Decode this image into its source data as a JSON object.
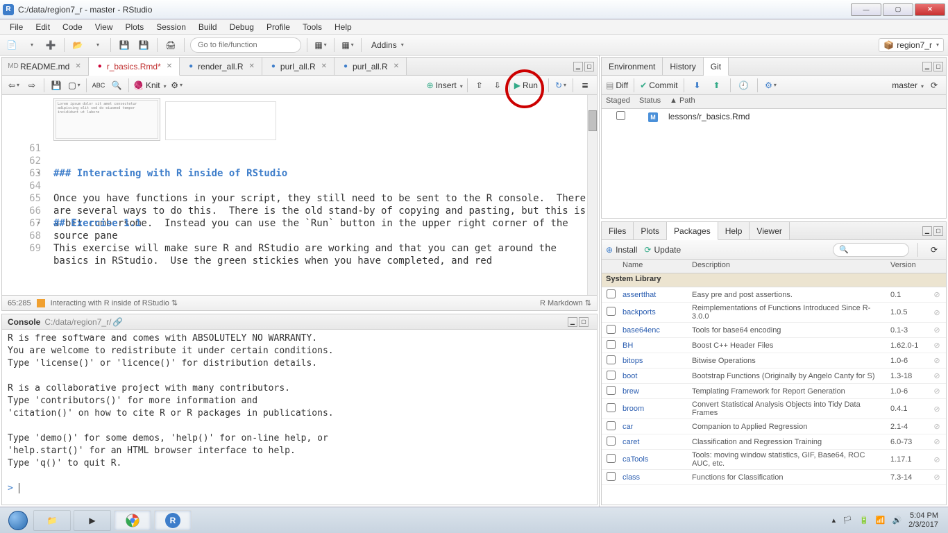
{
  "window": {
    "title": "C:/data/region7_r - master - RStudio"
  },
  "menu": [
    "File",
    "Edit",
    "Code",
    "View",
    "Plots",
    "Session",
    "Build",
    "Debug",
    "Profile",
    "Tools",
    "Help"
  ],
  "main_toolbar": {
    "search_placeholder": "Go to file/function",
    "addins": "Addins",
    "project": "region7_r"
  },
  "source": {
    "tabs": [
      {
        "label": "README.md",
        "icon": "MD",
        "modified": false
      },
      {
        "label": "r_basics.Rmd*",
        "icon": "Rmd",
        "modified": true
      },
      {
        "label": "render_all.R",
        "icon": "R",
        "modified": false
      },
      {
        "label": "purl_all.R",
        "icon": "R",
        "modified": false
      },
      {
        "label": "purl_all.R",
        "icon": "R",
        "modified": false
      }
    ],
    "toolbar": {
      "knit": "Knit",
      "insert": "Insert",
      "run": "Run"
    },
    "lines": [
      {
        "n": 61,
        "text": ""
      },
      {
        "n": 62,
        "text": ""
      },
      {
        "n": 63,
        "text": "### Interacting with R inside of RStudio",
        "cls": "md-h",
        "fold": true
      },
      {
        "n": 64,
        "text": ""
      },
      {
        "n": 65,
        "text": "Once you have functions in your script, they still need to be sent to the R console.  There are several ways to do this.  There is the old stand-by of copying and pasting, but this is a bit cumbersome.  Instead you can use the `Run` button in the upper right corner of the source pane",
        "wrap": true
      },
      {
        "n": 66,
        "text": ""
      },
      {
        "n": 67,
        "text": "## Exercise 1.1",
        "cls": "md-h",
        "fold": true
      },
      {
        "n": 68,
        "text": ""
      },
      {
        "n": 69,
        "text": "This exercise will make sure R and RStudio are working and that you can get around the basics in RStudio.  Use the green stickies when you have completed, and red",
        "wrap": true
      }
    ],
    "status": {
      "pos": "65:285",
      "breadcrumb": "Interacting with R inside of RStudio",
      "mode": "R Markdown"
    }
  },
  "console": {
    "title": "Console",
    "path": "C:/data/region7_r/",
    "body": "R is free software and comes with ABSOLUTELY NO WARRANTY.\nYou are welcome to redistribute it under certain conditions.\nType 'license()' or 'licence()' for distribution details.\n\nR is a collaborative project with many contributors.\nType 'contributors()' for more information and\n'citation()' on how to cite R or R packages in publications.\n\nType 'demo()' for some demos, 'help()' for on-line help, or\n'help.start()' for an HTML browser interface to help.\nType 'q()' to quit R.\n"
  },
  "env": {
    "tabs": [
      "Environment",
      "History",
      "Git"
    ],
    "toolbar": {
      "diff": "Diff",
      "commit": "Commit",
      "branch": "master"
    },
    "headers": {
      "staged": "Staged",
      "status": "Status",
      "path": "▲ Path"
    },
    "rows": [
      {
        "status": "M",
        "path": "lessons/r_basics.Rmd"
      }
    ]
  },
  "pkg": {
    "tabs": [
      "Files",
      "Plots",
      "Packages",
      "Help",
      "Viewer"
    ],
    "toolbar": {
      "install": "Install",
      "update": "Update"
    },
    "headers": {
      "name": "Name",
      "desc": "Description",
      "ver": "Version"
    },
    "section": "System Library",
    "rows": [
      {
        "name": "assertthat",
        "desc": "Easy pre and post assertions.",
        "ver": "0.1"
      },
      {
        "name": "backports",
        "desc": "Reimplementations of Functions Introduced Since R-3.0.0",
        "ver": "1.0.5"
      },
      {
        "name": "base64enc",
        "desc": "Tools for base64 encoding",
        "ver": "0.1-3"
      },
      {
        "name": "BH",
        "desc": "Boost C++ Header Files",
        "ver": "1.62.0-1"
      },
      {
        "name": "bitops",
        "desc": "Bitwise Operations",
        "ver": "1.0-6"
      },
      {
        "name": "boot",
        "desc": "Bootstrap Functions (Originally by Angelo Canty for S)",
        "ver": "1.3-18"
      },
      {
        "name": "brew",
        "desc": "Templating Framework for Report Generation",
        "ver": "1.0-6"
      },
      {
        "name": "broom",
        "desc": "Convert Statistical Analysis Objects into Tidy Data Frames",
        "ver": "0.4.1"
      },
      {
        "name": "car",
        "desc": "Companion to Applied Regression",
        "ver": "2.1-4"
      },
      {
        "name": "caret",
        "desc": "Classification and Regression Training",
        "ver": "6.0-73"
      },
      {
        "name": "caTools",
        "desc": "Tools: moving window statistics, GIF, Base64, ROC AUC, etc.",
        "ver": "1.17.1"
      },
      {
        "name": "class",
        "desc": "Functions for Classification",
        "ver": "7.3-14"
      }
    ]
  },
  "taskbar": {
    "time": "5:04 PM",
    "date": "2/3/2017"
  }
}
